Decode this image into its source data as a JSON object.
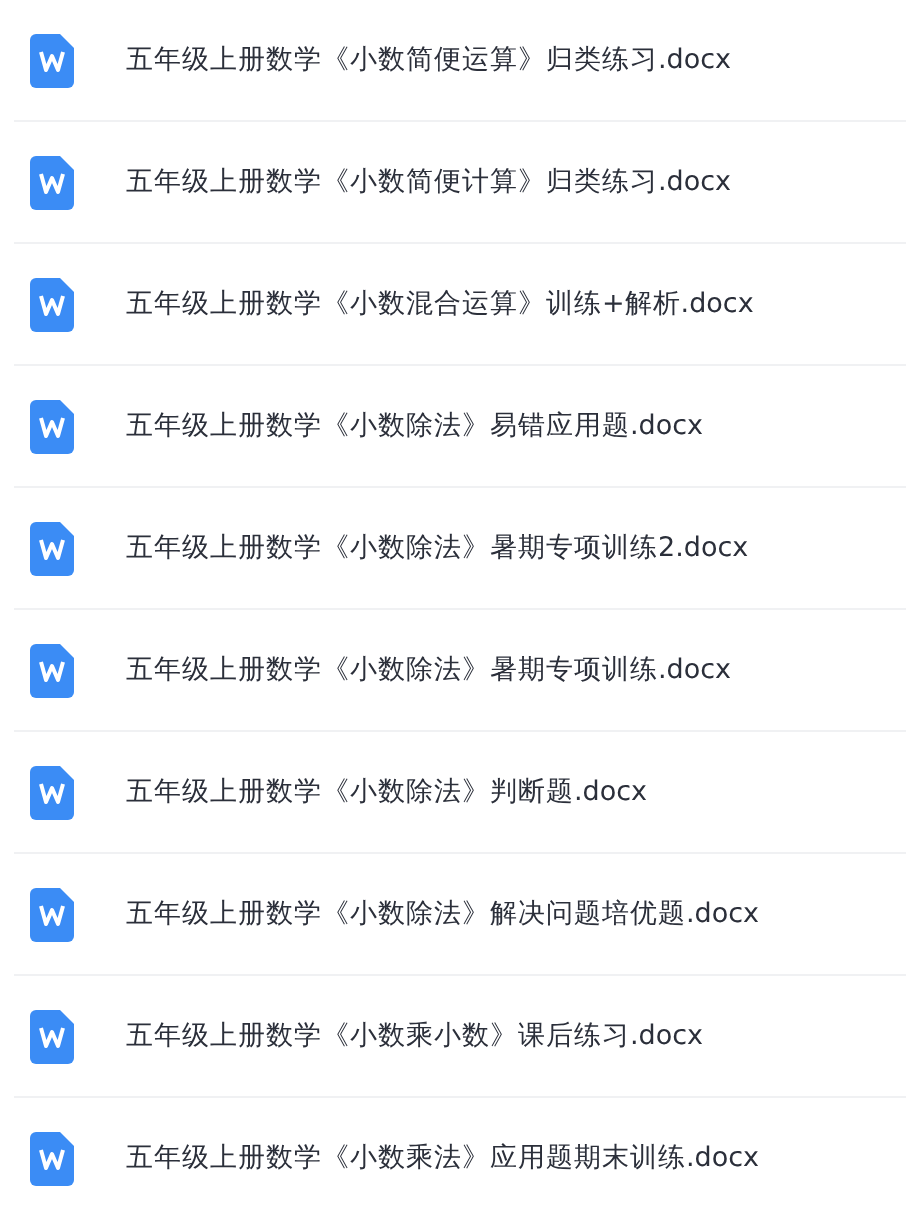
{
  "files": [
    {
      "name": "五年级上册数学《小数简便运算》归类练习.docx"
    },
    {
      "name": "五年级上册数学《小数简便计算》归类练习.docx"
    },
    {
      "name": "五年级上册数学《小数混合运算》训练+解析.docx"
    },
    {
      "name": "五年级上册数学《小数除法》易错应用题.docx"
    },
    {
      "name": "五年级上册数学《小数除法》暑期专项训练2.docx"
    },
    {
      "name": "五年级上册数学《小数除法》暑期专项训练.docx"
    },
    {
      "name": "五年级上册数学《小数除法》判断题.docx"
    },
    {
      "name": "五年级上册数学《小数除法》解决问题培优题.docx"
    },
    {
      "name": "五年级上册数学《小数乘小数》课后练习.docx"
    },
    {
      "name": "五年级上册数学《小数乘法》应用题期末训练.docx"
    }
  ]
}
